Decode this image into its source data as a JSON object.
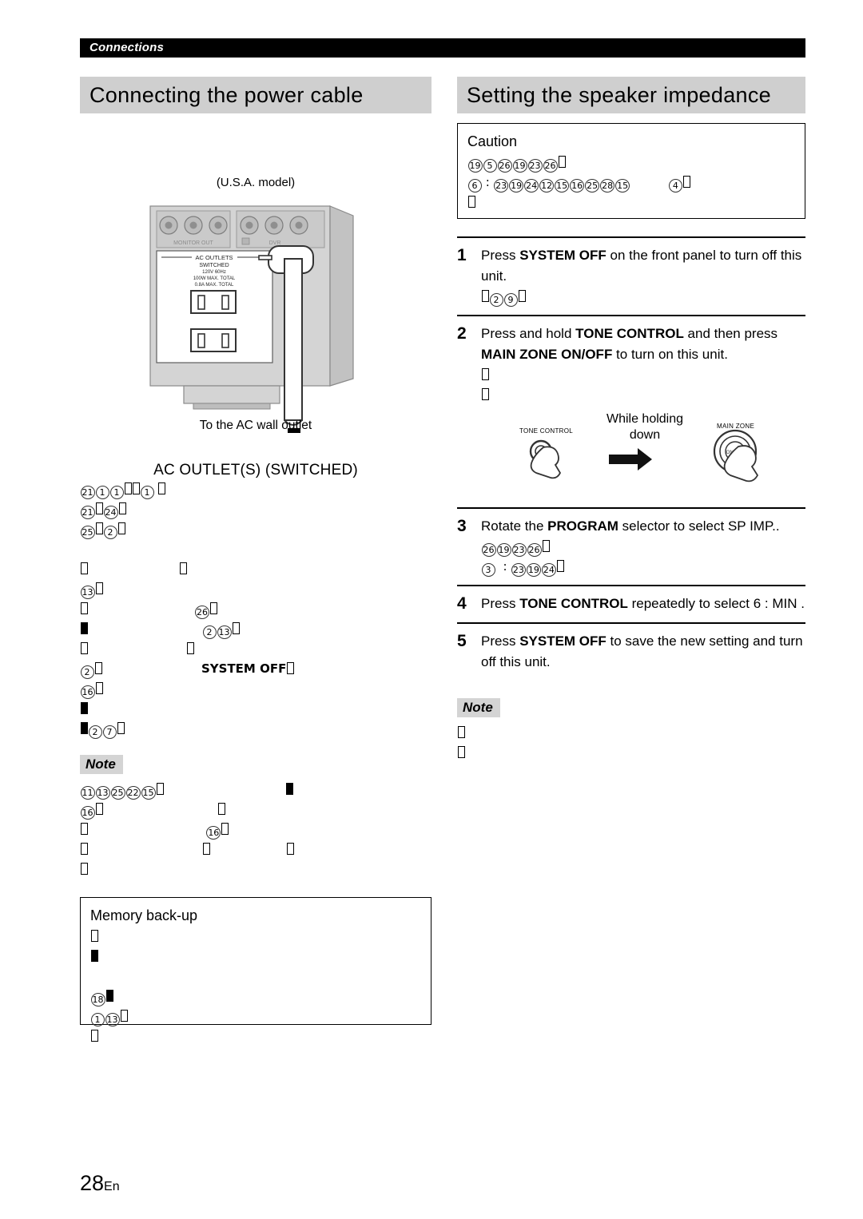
{
  "running_header": "Connections",
  "page_footer": {
    "number": "28",
    "lang": "En"
  },
  "left_column": {
    "section_title": "Connecting the power cable",
    "figure": {
      "model_label": "(U.S.A. model)",
      "panel_labels": {
        "monitor_out": "MONITOR OUT",
        "dvr": "DVR",
        "ac_outlets": "AC OUTLETS",
        "switched": "SWITCHED",
        "voltage": "120V 60Hz",
        "watt_total": "100W MAX. TOTAL",
        "amp_total": "0.8A MAX. TOTAL"
      },
      "arrow_caption": "To the AC wall outlet"
    },
    "subhead": "AC OUTLET(S) (SWITCHED)",
    "body_lines": [
      [
        {
          "t": "circ",
          "v": "21"
        },
        {
          "t": "circ",
          "v": "1"
        },
        {
          "t": "circ",
          "v": "1"
        },
        {
          "t": "tofu"
        },
        {
          "t": "tofu"
        },
        {
          "t": "circ",
          "v": "1"
        },
        {
          "t": "sp"
        },
        {
          "t": "tofu"
        }
      ],
      [
        {
          "t": "circ",
          "v": "21"
        },
        {
          "t": "tofu"
        },
        {
          "t": "circ",
          "v": "24"
        },
        {
          "t": "tofu"
        }
      ],
      [
        {
          "t": "circ",
          "v": "25"
        },
        {
          "t": "tofu"
        },
        {
          "t": "circ",
          "v": "2"
        },
        {
          "t": "tofu"
        }
      ],
      [],
      [
        {
          "t": "tofu"
        },
        {
          "t": "sp",
          "n": 24
        },
        {
          "t": "tofu"
        }
      ],
      [
        {
          "t": "circ",
          "v": "13"
        },
        {
          "t": "tofu"
        }
      ],
      [
        {
          "t": "tofu"
        },
        {
          "t": "sp",
          "n": 28
        },
        {
          "t": "circ",
          "v": "26"
        },
        {
          "t": "tofu"
        }
      ],
      [
        {
          "t": "tofu",
          "solid": true
        },
        {
          "t": "sp",
          "n": 30
        },
        {
          "t": "circ",
          "v": "2"
        },
        {
          "t": "circ",
          "v": "13"
        },
        {
          "t": "tofu"
        }
      ],
      [
        {
          "t": "tofu"
        },
        {
          "t": "sp",
          "n": 26
        },
        {
          "t": "tofu"
        }
      ],
      [
        {
          "t": "circ",
          "v": "2"
        },
        {
          "t": "tofu"
        },
        {
          "t": "sp",
          "n": 26
        },
        {
          "t": "kw",
          "v": "SYSTEM OFF"
        },
        {
          "t": "tofu"
        }
      ],
      [
        {
          "t": "circ",
          "v": "16"
        },
        {
          "t": "tofu"
        }
      ],
      [
        {
          "t": "tofu",
          "solid": true
        }
      ],
      [
        {
          "t": "tofu",
          "solid": true
        },
        {
          "t": "circ",
          "v": "2"
        },
        {
          "t": "circ",
          "v": "7"
        },
        {
          "t": "tofu"
        }
      ]
    ],
    "note_label": "Note",
    "note_lines": [
      [
        {
          "t": "circ",
          "v": "11"
        },
        {
          "t": "circ",
          "v": "13"
        },
        {
          "t": "circ",
          "v": "25"
        },
        {
          "t": "circ",
          "v": "22"
        },
        {
          "t": "circ",
          "v": "15"
        },
        {
          "t": "tofu"
        },
        {
          "t": "sp",
          "n": 32
        },
        {
          "t": "tofu",
          "solid": true
        }
      ],
      [
        {
          "t": "circ",
          "v": "16"
        },
        {
          "t": "tofu"
        },
        {
          "t": "sp",
          "n": 30
        },
        {
          "t": "tofu"
        }
      ],
      [
        {
          "t": "tofu"
        },
        {
          "t": "sp",
          "n": 31
        },
        {
          "t": "circ",
          "v": "16"
        },
        {
          "t": "tofu"
        }
      ],
      [
        {
          "t": "tofu"
        },
        {
          "t": "sp",
          "n": 30
        },
        {
          "t": "tofu"
        },
        {
          "t": "sp",
          "n": 20
        },
        {
          "t": "tofu"
        }
      ],
      [
        {
          "t": "tofu"
        }
      ]
    ],
    "memory_box": {
      "title": "Memory back-up",
      "lines": [
        [
          {
            "t": "tofu"
          }
        ],
        [
          {
            "t": "tofu",
            "solid": true
          }
        ],
        [],
        [
          {
            "t": "circ",
            "v": "18"
          },
          {
            "t": "tofu",
            "solid": true
          }
        ],
        [
          {
            "t": "circ",
            "v": "1"
          },
          {
            "t": "circ",
            "v": "13"
          },
          {
            "t": "tofu"
          }
        ],
        [
          {
            "t": "tofu"
          }
        ]
      ]
    }
  },
  "right_column": {
    "section_title": "Setting the speaker impedance",
    "caution_box": {
      "title": "Caution",
      "lines": [
        [
          {
            "t": "circ",
            "v": "19"
          },
          {
            "t": "circ",
            "v": "5"
          },
          {
            "t": "circ",
            "v": "26"
          },
          {
            "t": "circ",
            "v": "19"
          },
          {
            "t": "circ",
            "v": "23"
          },
          {
            "t": "circ",
            "v": "26"
          },
          {
            "t": "tofu"
          }
        ],
        [
          {
            "t": "circ",
            "v": "6"
          },
          {
            "t": "sp"
          },
          {
            "t": "txt",
            "v": ":"
          },
          {
            "t": "sp"
          },
          {
            "t": "circ",
            "v": "23"
          },
          {
            "t": "circ",
            "v": "19"
          },
          {
            "t": "circ",
            "v": "24"
          },
          {
            "t": "circ",
            "v": "12"
          },
          {
            "t": "circ",
            "v": "15"
          },
          {
            "t": "circ",
            "v": "16"
          },
          {
            "t": "circ",
            "v": "25"
          },
          {
            "t": "circ",
            "v": "28"
          },
          {
            "t": "circ",
            "v": "15"
          },
          {
            "t": "sp",
            "n": 10
          },
          {
            "t": "circ",
            "v": "4"
          },
          {
            "t": "tofu"
          }
        ],
        [
          {
            "t": "tofu"
          }
        ]
      ]
    },
    "steps": [
      {
        "num": "1",
        "rich": [
          {
            "t": "txt",
            "v": "Press "
          },
          {
            "t": "kw",
            "v": "SYSTEM OFF"
          },
          {
            "t": "txt",
            "v": " on the front panel to turn off this unit."
          }
        ],
        "glyph_lines": [
          [
            {
              "t": "tofu"
            },
            {
              "t": "circ",
              "v": "2"
            },
            {
              "t": "circ",
              "v": "9"
            },
            {
              "t": "tofu"
            }
          ]
        ],
        "has_figure": false
      },
      {
        "num": "2",
        "rich": [
          {
            "t": "txt",
            "v": "Press and hold "
          },
          {
            "t": "kw",
            "v": "TONE CONTROL"
          },
          {
            "t": "txt",
            "v": " and then press "
          },
          {
            "t": "kw",
            "v": "MAIN ZONE ON/OFF"
          },
          {
            "t": "txt",
            "v": " to turn on this unit."
          }
        ],
        "glyph_lines": [
          [
            {
              "t": "tofu"
            }
          ],
          [
            {
              "t": "tofu"
            }
          ]
        ],
        "has_figure": true,
        "figure": {
          "left_caption": "TONE CONTROL",
          "middle_text": "While holding down",
          "right_caption": "MAIN ZONE",
          "right_knob_label": "ON/OFF"
        }
      },
      {
        "num": "3",
        "rich": [
          {
            "t": "txt",
            "v": "Rotate the "
          },
          {
            "t": "kw",
            "v": "PROGRAM"
          },
          {
            "t": "txt",
            "v": " selector to select "
          },
          {
            "t": "txt",
            "v": "SP IMP.."
          }
        ],
        "glyph_lines": [
          [
            {
              "t": "circ",
              "v": "26"
            },
            {
              "t": "circ",
              "v": "19"
            },
            {
              "t": "circ",
              "v": "23"
            },
            {
              "t": "circ",
              "v": "26"
            },
            {
              "t": "tofu"
            }
          ],
          [
            {
              "t": "circ",
              "v": "3"
            },
            {
              "t": "sp",
              "n": 2
            },
            {
              "t": "txt",
              "v": ":"
            },
            {
              "t": "sp"
            },
            {
              "t": "circ",
              "v": "23"
            },
            {
              "t": "circ",
              "v": "19"
            },
            {
              "t": "circ",
              "v": "24"
            },
            {
              "t": "tofu"
            }
          ]
        ],
        "has_figure": false
      },
      {
        "num": "4",
        "rich": [
          {
            "t": "txt",
            "v": "Press "
          },
          {
            "t": "kw",
            "v": "TONE CONTROL"
          },
          {
            "t": "txt",
            "v": " repeatedly to select 6 : MIN ."
          }
        ],
        "glyph_lines": [],
        "has_figure": false
      },
      {
        "num": "5",
        "rich": [
          {
            "t": "txt",
            "v": "Press "
          },
          {
            "t": "kw",
            "v": "SYSTEM OFF"
          },
          {
            "t": "txt",
            "v": " to save the new setting and turn off this unit."
          }
        ],
        "glyph_lines": [],
        "has_figure": false
      }
    ],
    "note_label": "Note",
    "note_lines": [
      [
        {
          "t": "tofu"
        }
      ],
      [
        {
          "t": "tofu"
        }
      ]
    ]
  }
}
